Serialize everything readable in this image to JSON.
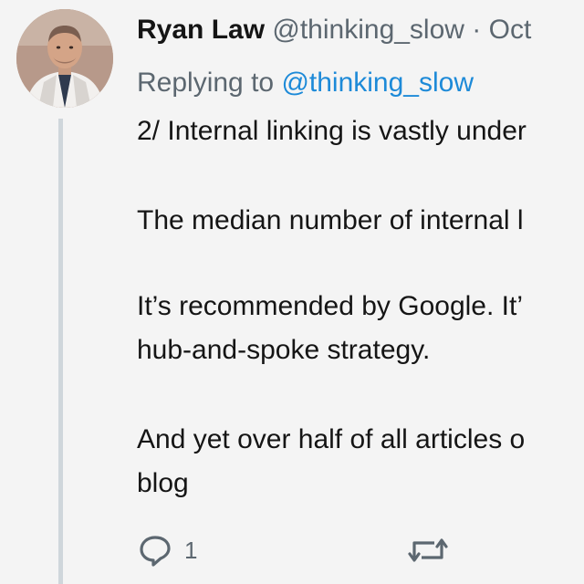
{
  "author": {
    "name": "Ryan Law",
    "handle": "@thinking_slow",
    "separator": "·",
    "date": "Oct"
  },
  "reply": {
    "prefix": "Replying to ",
    "handle": "@thinking_slow"
  },
  "body": {
    "lines": [
      "2/ Internal linking is vastly under",
      "The median number of internal l",
      "It’s recommended by Google. It’",
      "hub-and-spoke strategy.",
      "And yet over half of all articles o",
      "blog"
    ]
  },
  "actions": {
    "reply": {
      "icon": "reply-bubble-icon",
      "count": "1"
    },
    "retweet": {
      "icon": "retweet-icon",
      "count": ""
    }
  },
  "colors": {
    "background": "#f4f4f4",
    "text": "#151515",
    "muted": "#5c6770",
    "link": "#1d8ad8",
    "thread_line": "#cfd6db"
  }
}
